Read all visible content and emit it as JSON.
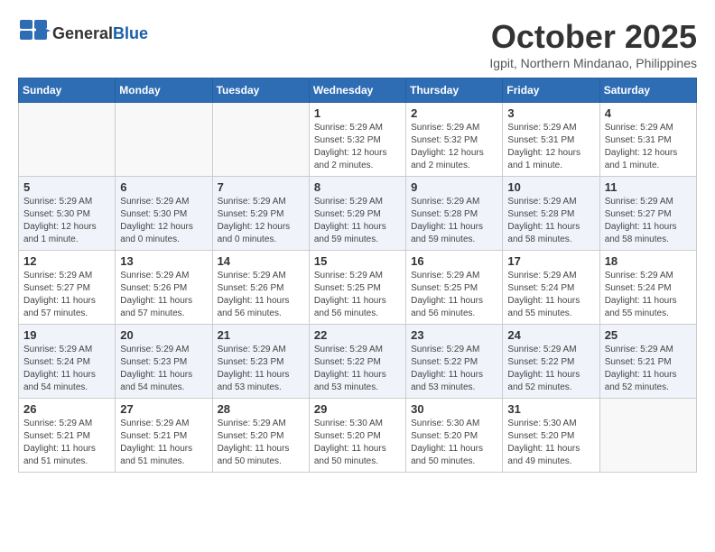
{
  "header": {
    "logo_general": "General",
    "logo_blue": "Blue",
    "title": "October 2025",
    "subtitle": "Igpit, Northern Mindanao, Philippines"
  },
  "weekdays": [
    "Sunday",
    "Monday",
    "Tuesday",
    "Wednesday",
    "Thursday",
    "Friday",
    "Saturday"
  ],
  "weeks": [
    [
      {
        "day": "",
        "info": ""
      },
      {
        "day": "",
        "info": ""
      },
      {
        "day": "",
        "info": ""
      },
      {
        "day": "1",
        "info": "Sunrise: 5:29 AM\nSunset: 5:32 PM\nDaylight: 12 hours\nand 2 minutes."
      },
      {
        "day": "2",
        "info": "Sunrise: 5:29 AM\nSunset: 5:32 PM\nDaylight: 12 hours\nand 2 minutes."
      },
      {
        "day": "3",
        "info": "Sunrise: 5:29 AM\nSunset: 5:31 PM\nDaylight: 12 hours\nand 1 minute."
      },
      {
        "day": "4",
        "info": "Sunrise: 5:29 AM\nSunset: 5:31 PM\nDaylight: 12 hours\nand 1 minute."
      }
    ],
    [
      {
        "day": "5",
        "info": "Sunrise: 5:29 AM\nSunset: 5:30 PM\nDaylight: 12 hours\nand 1 minute."
      },
      {
        "day": "6",
        "info": "Sunrise: 5:29 AM\nSunset: 5:30 PM\nDaylight: 12 hours\nand 0 minutes."
      },
      {
        "day": "7",
        "info": "Sunrise: 5:29 AM\nSunset: 5:29 PM\nDaylight: 12 hours\nand 0 minutes."
      },
      {
        "day": "8",
        "info": "Sunrise: 5:29 AM\nSunset: 5:29 PM\nDaylight: 11 hours\nand 59 minutes."
      },
      {
        "day": "9",
        "info": "Sunrise: 5:29 AM\nSunset: 5:28 PM\nDaylight: 11 hours\nand 59 minutes."
      },
      {
        "day": "10",
        "info": "Sunrise: 5:29 AM\nSunset: 5:28 PM\nDaylight: 11 hours\nand 58 minutes."
      },
      {
        "day": "11",
        "info": "Sunrise: 5:29 AM\nSunset: 5:27 PM\nDaylight: 11 hours\nand 58 minutes."
      }
    ],
    [
      {
        "day": "12",
        "info": "Sunrise: 5:29 AM\nSunset: 5:27 PM\nDaylight: 11 hours\nand 57 minutes."
      },
      {
        "day": "13",
        "info": "Sunrise: 5:29 AM\nSunset: 5:26 PM\nDaylight: 11 hours\nand 57 minutes."
      },
      {
        "day": "14",
        "info": "Sunrise: 5:29 AM\nSunset: 5:26 PM\nDaylight: 11 hours\nand 56 minutes."
      },
      {
        "day": "15",
        "info": "Sunrise: 5:29 AM\nSunset: 5:25 PM\nDaylight: 11 hours\nand 56 minutes."
      },
      {
        "day": "16",
        "info": "Sunrise: 5:29 AM\nSunset: 5:25 PM\nDaylight: 11 hours\nand 56 minutes."
      },
      {
        "day": "17",
        "info": "Sunrise: 5:29 AM\nSunset: 5:24 PM\nDaylight: 11 hours\nand 55 minutes."
      },
      {
        "day": "18",
        "info": "Sunrise: 5:29 AM\nSunset: 5:24 PM\nDaylight: 11 hours\nand 55 minutes."
      }
    ],
    [
      {
        "day": "19",
        "info": "Sunrise: 5:29 AM\nSunset: 5:24 PM\nDaylight: 11 hours\nand 54 minutes."
      },
      {
        "day": "20",
        "info": "Sunrise: 5:29 AM\nSunset: 5:23 PM\nDaylight: 11 hours\nand 54 minutes."
      },
      {
        "day": "21",
        "info": "Sunrise: 5:29 AM\nSunset: 5:23 PM\nDaylight: 11 hours\nand 53 minutes."
      },
      {
        "day": "22",
        "info": "Sunrise: 5:29 AM\nSunset: 5:22 PM\nDaylight: 11 hours\nand 53 minutes."
      },
      {
        "day": "23",
        "info": "Sunrise: 5:29 AM\nSunset: 5:22 PM\nDaylight: 11 hours\nand 53 minutes."
      },
      {
        "day": "24",
        "info": "Sunrise: 5:29 AM\nSunset: 5:22 PM\nDaylight: 11 hours\nand 52 minutes."
      },
      {
        "day": "25",
        "info": "Sunrise: 5:29 AM\nSunset: 5:21 PM\nDaylight: 11 hours\nand 52 minutes."
      }
    ],
    [
      {
        "day": "26",
        "info": "Sunrise: 5:29 AM\nSunset: 5:21 PM\nDaylight: 11 hours\nand 51 minutes."
      },
      {
        "day": "27",
        "info": "Sunrise: 5:29 AM\nSunset: 5:21 PM\nDaylight: 11 hours\nand 51 minutes."
      },
      {
        "day": "28",
        "info": "Sunrise: 5:29 AM\nSunset: 5:20 PM\nDaylight: 11 hours\nand 50 minutes."
      },
      {
        "day": "29",
        "info": "Sunrise: 5:30 AM\nSunset: 5:20 PM\nDaylight: 11 hours\nand 50 minutes."
      },
      {
        "day": "30",
        "info": "Sunrise: 5:30 AM\nSunset: 5:20 PM\nDaylight: 11 hours\nand 50 minutes."
      },
      {
        "day": "31",
        "info": "Sunrise: 5:30 AM\nSunset: 5:20 PM\nDaylight: 11 hours\nand 49 minutes."
      },
      {
        "day": "",
        "info": ""
      }
    ]
  ]
}
